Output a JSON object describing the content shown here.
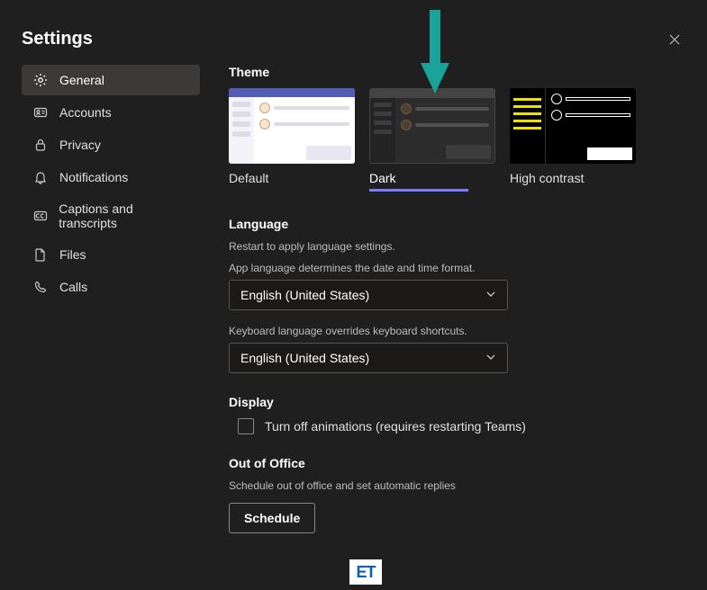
{
  "window": {
    "title": "Settings"
  },
  "sidebar": {
    "items": [
      {
        "label": "General"
      },
      {
        "label": "Accounts"
      },
      {
        "label": "Privacy"
      },
      {
        "label": "Notifications"
      },
      {
        "label": "Captions and transcripts"
      },
      {
        "label": "Files"
      },
      {
        "label": "Calls"
      }
    ]
  },
  "theme": {
    "section_label": "Theme",
    "options": [
      {
        "label": "Default"
      },
      {
        "label": "Dark"
      },
      {
        "label": "High contrast"
      }
    ],
    "selected": "Dark"
  },
  "language": {
    "section_label": "Language",
    "restart_hint": "Restart to apply language settings.",
    "app_lang_label": "App language determines the date and time format.",
    "app_lang_value": "English (United States)",
    "kbd_lang_label": "Keyboard language overrides keyboard shortcuts.",
    "kbd_lang_value": "English (United States)"
  },
  "display": {
    "section_label": "Display",
    "animations_label": "Turn off animations (requires restarting Teams)",
    "animations_checked": false
  },
  "out_of_office": {
    "section_label": "Out of Office",
    "description": "Schedule out of office and set automatic replies",
    "button_label": "Schedule"
  },
  "watermark": "ET"
}
